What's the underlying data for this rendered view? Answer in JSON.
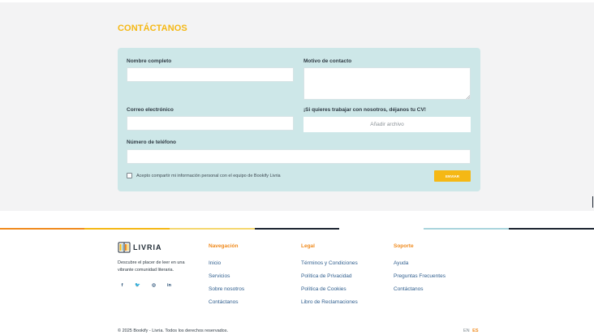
{
  "contact": {
    "title": "CONTÁCTANOS",
    "labels": {
      "name": "Nombre completo",
      "reason": "Motivo de contacto",
      "email": "Correo electrónico",
      "cv": "¡Si quieres trabajar con nosotros, déjanos tu CV!",
      "phone": "Número de teléfono"
    },
    "values": {
      "name": "",
      "reason": "",
      "email": "",
      "phone": ""
    },
    "upload_label": "Añadir archivo",
    "consent_text": "Acepto compartir mi información personal con el equipo de Bookify Livria",
    "consent_checked": false,
    "send_label": "ENVIAR"
  },
  "footer": {
    "brand_name": "LIVRIA",
    "brand_description": "Descubre el placer de leer en una vibrante comunidad literaria.",
    "social": [
      {
        "icon": "facebook-icon",
        "glyph": "f"
      },
      {
        "icon": "twitter-icon",
        "glyph": "🐦"
      },
      {
        "icon": "instagram-icon",
        "glyph": "◎"
      },
      {
        "icon": "linkedin-icon",
        "glyph": "in"
      }
    ],
    "columns": [
      {
        "title": "Navegación",
        "links": [
          "Inicio",
          "Servicios",
          "Sobre nosotros",
          "Contáctanos"
        ]
      },
      {
        "title": "Legal",
        "links": [
          "Términos y Condiciones",
          "Política de Privacidad",
          "Política de Cookies",
          "Libro de Reclamaciones"
        ]
      },
      {
        "title": "Soporte",
        "links": [
          "Ayuda",
          "Preguntas Frecuentes",
          "Contáctanos"
        ]
      }
    ],
    "copyright": "© 2025 Bookify - Livria. Todos los derechos reservados.",
    "languages": {
      "en": "EN",
      "es": "ES",
      "active": "ES"
    }
  },
  "colors": {
    "accent_yellow": "#f5b814",
    "accent_orange": "#f08a1c",
    "navy": "#1b2430",
    "form_background": "#cde7e8",
    "link_blue": "#2f5e8e"
  }
}
